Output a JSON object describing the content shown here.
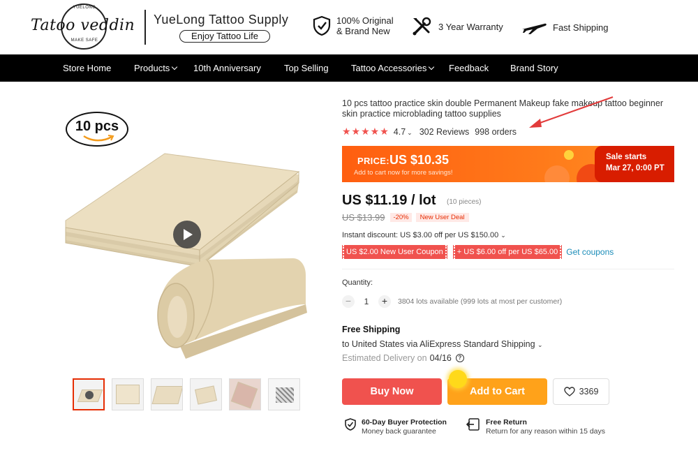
{
  "header": {
    "logo": {
      "top_text": "YUELONG",
      "script_text": "Tatoo veddin",
      "bottom_text": "MAKE SAFE"
    },
    "brand_name": "YueLong Tattoo Supply",
    "slogan": "Enjoy Tattoo Life",
    "features": [
      {
        "icon": "shield-check-icon",
        "line1": "100% Original",
        "line2": "& Brand New"
      },
      {
        "icon": "tools-icon",
        "label": "3 Year Warranty"
      },
      {
        "icon": "airplane-icon",
        "label": "Fast Shipping"
      }
    ]
  },
  "nav": {
    "items": [
      {
        "label": "Store Home",
        "dropdown": false
      },
      {
        "label": "Products",
        "dropdown": true
      },
      {
        "label": "10th Anniversary",
        "dropdown": false
      },
      {
        "label": "Top Selling",
        "dropdown": false
      },
      {
        "label": "Tattoo Accessories",
        "dropdown": true
      },
      {
        "label": "Feedback",
        "dropdown": false
      },
      {
        "label": "Brand Story",
        "dropdown": false
      }
    ]
  },
  "gallery": {
    "badge": "10 pcs",
    "thumbnail_count": 6,
    "active_thumbnail": 0
  },
  "product": {
    "title": "10 pcs tattoo practice skin double Permanent Makeup fake makeup tattoo beginner skin practice microblading tattoo supplies",
    "rating": "4.7",
    "stars": "★★★★★",
    "reviews": "302 Reviews",
    "orders": "998 orders",
    "promo": {
      "label": "PRICE:",
      "price": "US $10.35",
      "note": "Add to cart now for more savings!",
      "sale_line1": "Sale starts",
      "sale_line2": "Mar 27, 0:00 PT"
    },
    "price": "US $11.19 / lot",
    "pieces": "(10 pieces)",
    "old_price": "US $13.99",
    "discount": "-20%",
    "new_user_deal": "New User Deal",
    "instant_discount": "Instant discount: US $3.00 off per US $150.00",
    "coupons": [
      "US $2.00 New User Coupon",
      "+ US $6.00 off per US $65.00"
    ],
    "get_coupons": "Get coupons",
    "quantity_label": "Quantity:",
    "quantity": "1",
    "availability": "3804 lots available (999 lots at most per customer)",
    "shipping_title": "Free Shipping",
    "shipping_to": "to United States via AliExpress Standard Shipping",
    "delivery_label": "Estimated Delivery on",
    "delivery_date": "04/16",
    "buy_now": "Buy Now",
    "add_to_cart": "Add to Cart",
    "wishlist_count": "3369",
    "protection": {
      "title": "60-Day Buyer Protection",
      "sub": "Money back guarantee"
    },
    "free_return": {
      "title": "Free Return",
      "sub": "Return for any reason within 15 days"
    }
  },
  "colors": {
    "accent_red": "#f0524e",
    "promo_orange": "#ff5e10",
    "sale_red": "#d81d00",
    "cart_orange": "#ffa21a",
    "nav_bg": "#000000"
  }
}
